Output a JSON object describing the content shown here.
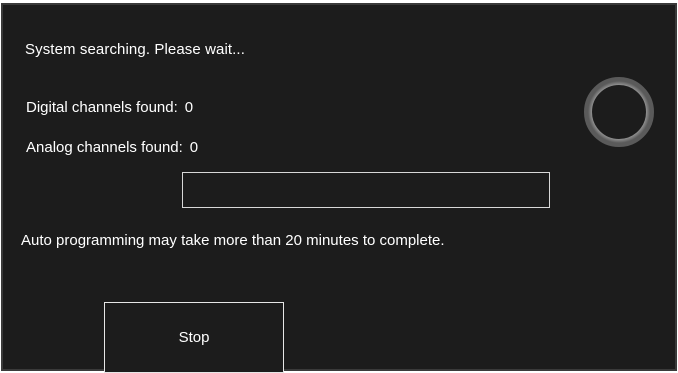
{
  "status": {
    "message": "System searching. Please wait..."
  },
  "counts": {
    "digital_label": "Digital channels found:",
    "digital_value": "0",
    "analog_label": "Analog channels found:",
    "analog_value": "0"
  },
  "progress": {
    "fraction": 0
  },
  "notice": {
    "text": "Auto programming may take more than 20 minutes to complete."
  },
  "actions": {
    "stop_label": "Stop"
  },
  "icons": {
    "busy": "loading-spinner-icon"
  },
  "colors": {
    "background": "#1c1c1c",
    "text": "#ffffff",
    "spinner_ring": "#8c8c8c",
    "border": "#e6e6e6"
  }
}
